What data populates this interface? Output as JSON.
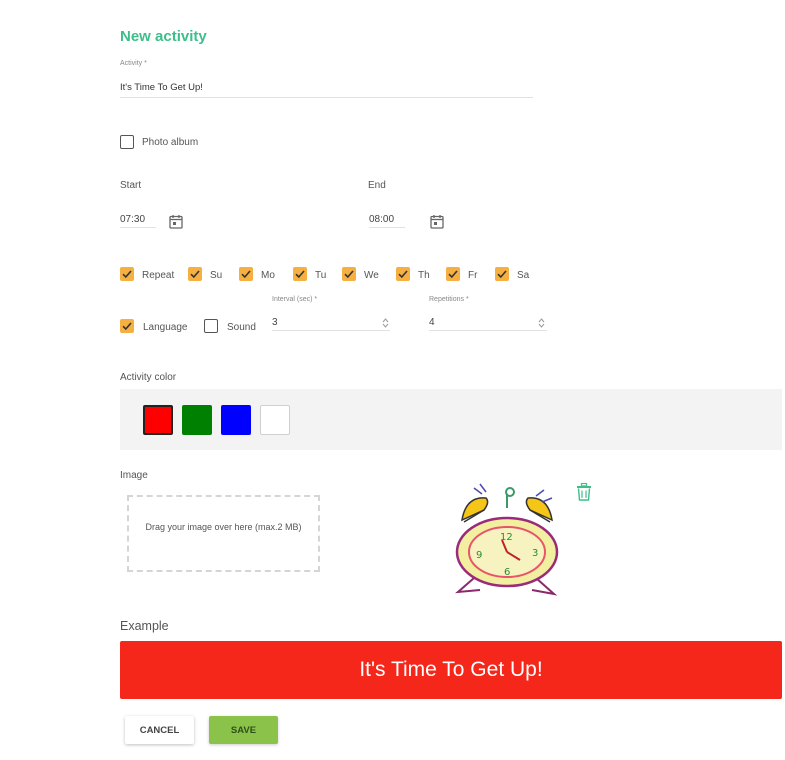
{
  "form": {
    "title": "New activity",
    "activity_label": "Activity *",
    "activity_value": "It's Time To Get Up!",
    "photo_album_label": "Photo album",
    "photo_album_checked": false
  },
  "time": {
    "start_label": "Start",
    "start_value": "07:30",
    "end_label": "End",
    "end_value": "08:00"
  },
  "days": [
    {
      "label": "Repeat",
      "checked": true
    },
    {
      "label": "Su",
      "checked": true
    },
    {
      "label": "Mo",
      "checked": true
    },
    {
      "label": "Tu",
      "checked": true
    },
    {
      "label": "We",
      "checked": true
    },
    {
      "label": "Th",
      "checked": true
    },
    {
      "label": "Fr",
      "checked": true
    },
    {
      "label": "Sa",
      "checked": true
    }
  ],
  "options": {
    "language_label": "Language",
    "language_checked": true,
    "sound_label": "Sound",
    "sound_checked": false,
    "interval_label": "Interval (sec) *",
    "interval_value": "3",
    "repetitions_label": "Repetitions *",
    "repetitions_value": "4"
  },
  "color": {
    "label": "Activity color",
    "swatches": [
      "#ff0000",
      "#008000",
      "#0000ff",
      "#ffffff"
    ],
    "selected": "#ff0000"
  },
  "image": {
    "label": "Image",
    "dropzone_text": "Drag your image over here (max.2 MB)"
  },
  "example": {
    "label": "Example",
    "text": "It's Time To Get Up!",
    "background": "#f5261a"
  },
  "buttons": {
    "cancel_label": "CANCEL",
    "save_label": "SAVE"
  },
  "icons": {
    "calendar": "calendar-icon",
    "trash": "trash-icon",
    "check": "check-icon"
  },
  "accent": "#3dbe8b",
  "checkbox_color": "#f5b041"
}
